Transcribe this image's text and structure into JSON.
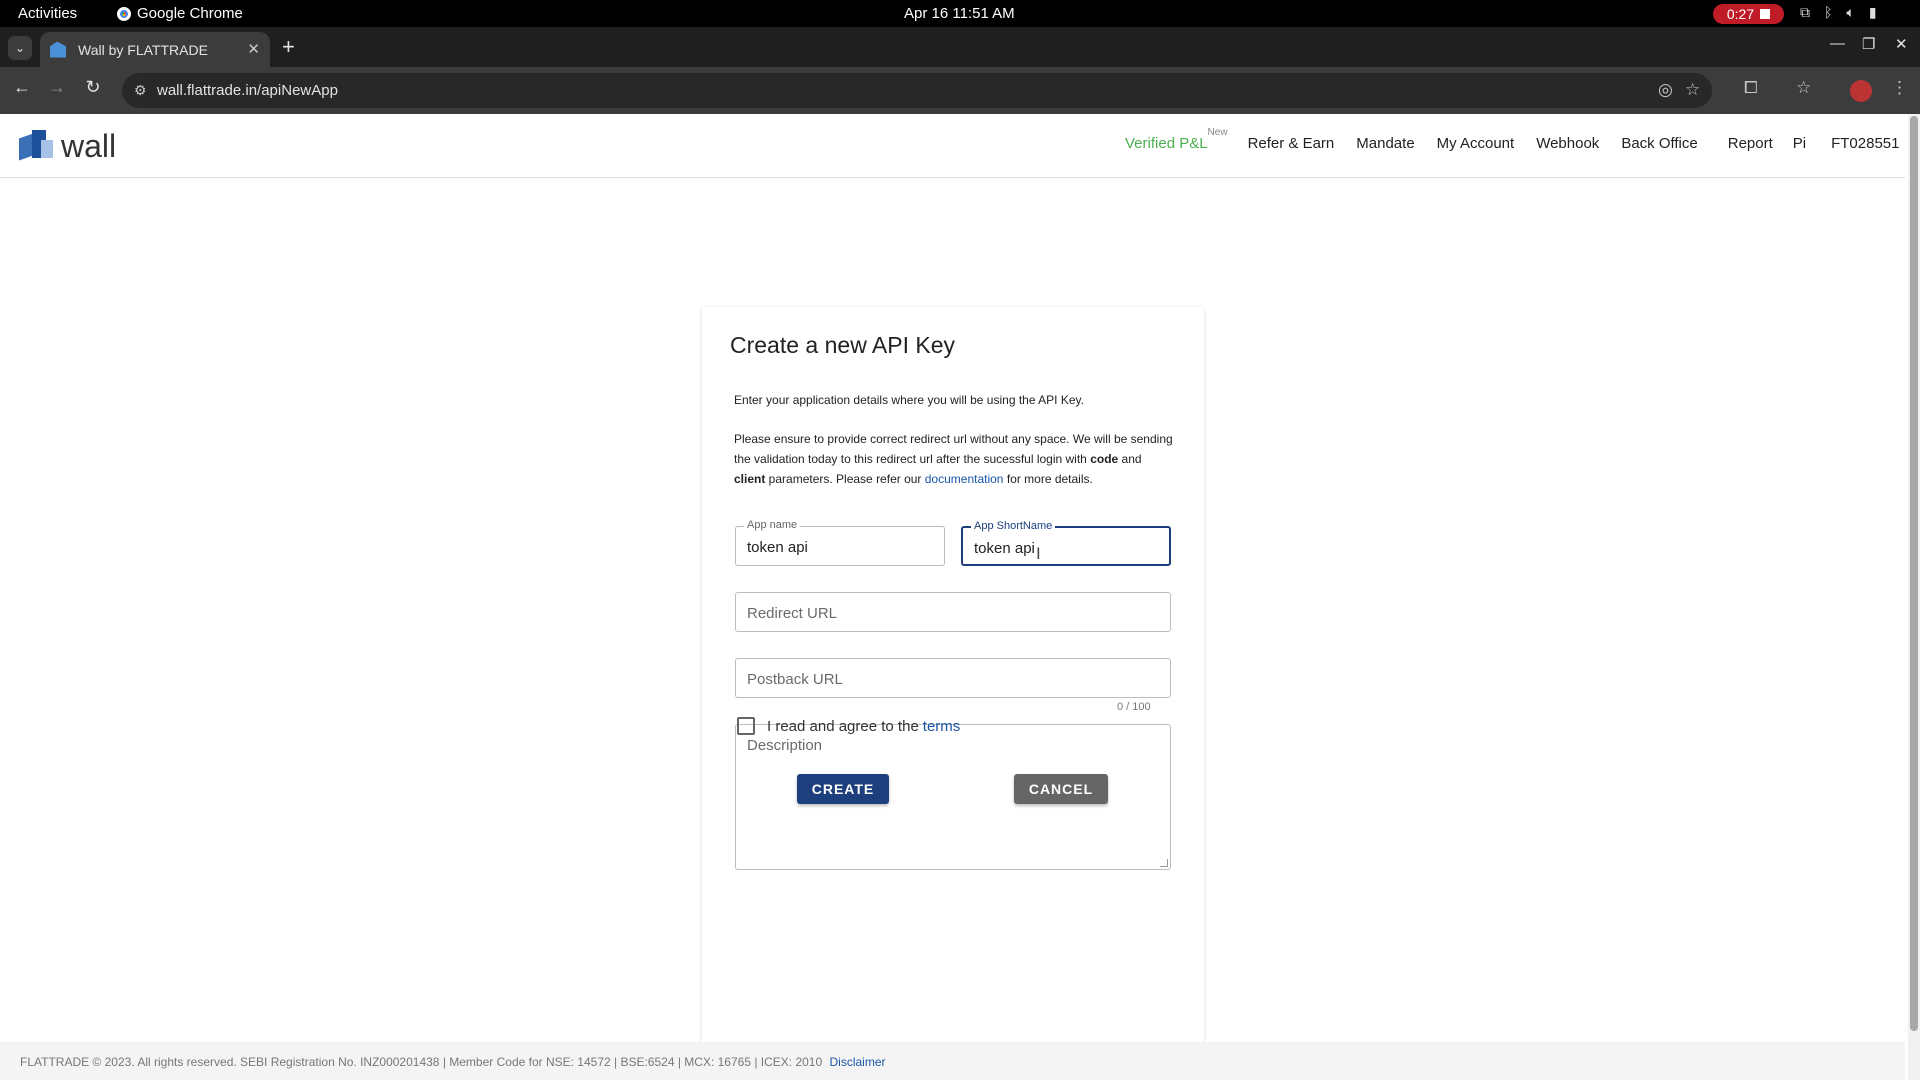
{
  "system_bar": {
    "activities": "Activities",
    "app_name": "Google Chrome",
    "clock": "Apr 16  11:51 AM",
    "recording_time": "0:27"
  },
  "browser": {
    "tab_title": "Wall by FLATTRADE",
    "url": "wall.flattrade.in/apiNewApp"
  },
  "header": {
    "logo_text": "wall",
    "nav": [
      {
        "label": "Verified P&L",
        "badge": "New"
      },
      {
        "label": "Refer & Earn"
      },
      {
        "label": "Mandate"
      },
      {
        "label": "My Account"
      },
      {
        "label": "Webhook"
      },
      {
        "label": "Back Office"
      },
      {
        "label": "Report"
      },
      {
        "label": "Pi"
      },
      {
        "label": "FT028551"
      }
    ]
  },
  "form": {
    "title": "Create a new API Key",
    "intro": "Enter your application details where you will be using the API Key.",
    "note_part1": "Please ensure to provide correct redirect url without any space. We will be sending the validation today to this redirect url after the sucessful login with ",
    "note_code": "code",
    "note_and": " and ",
    "note_client": "client",
    "note_part2": " parameters. Please refer our ",
    "note_link": "documentation",
    "note_part3": " for more details.",
    "app_name_label": "App name",
    "app_name_value": "token api",
    "short_name_label": "App ShortName",
    "short_name_value": "token api",
    "redirect_placeholder": "Redirect URL",
    "postback_placeholder": "Postback URL",
    "char_counter": "0 / 100",
    "description_placeholder": "Description",
    "terms_text": "I read and agree to the",
    "terms_link": "terms",
    "terms_checked": false,
    "create_label": "CREATE",
    "cancel_label": "CANCEL"
  },
  "footer": {
    "text": "FLATTRADE © 2023. All rights reserved. SEBI Registration No. INZ000201438 | Member Code for NSE: 14572 | BSE:6524 | MCX: 16765 | ICEX: 2010",
    "disclaimer": "Disclaimer"
  },
  "colors": {
    "primary": "#1e3f7d",
    "pnl_green": "#4caf50",
    "link": "#1a55a8",
    "cancel_grey": "#666666"
  }
}
